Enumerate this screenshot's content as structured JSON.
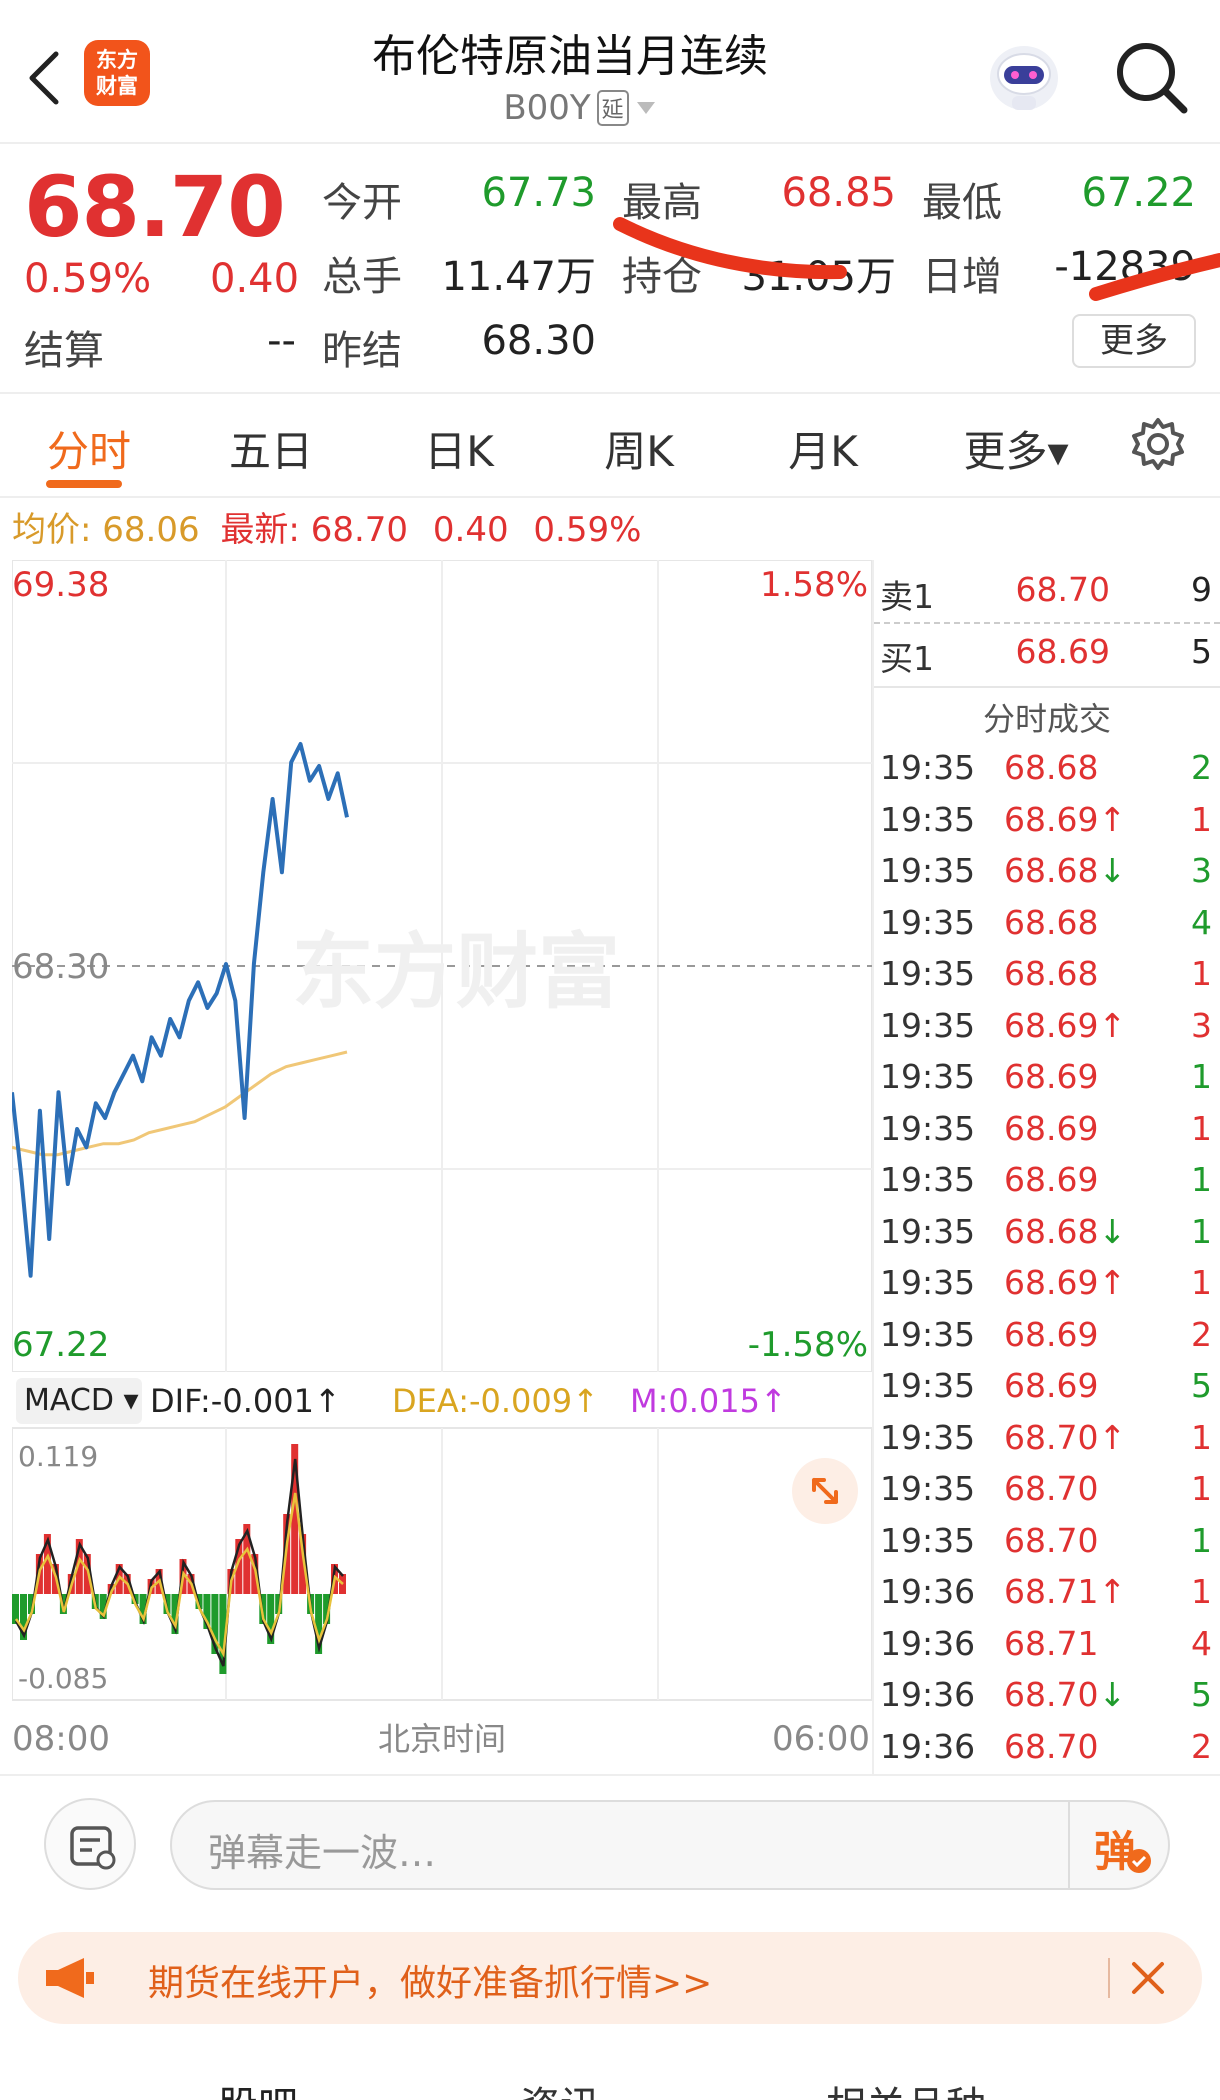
{
  "header": {
    "logo_text_line1": "东方",
    "logo_text_line2": "财富",
    "title": "布伦特原油当月连续",
    "code": "B00Y",
    "code_badge": "延"
  },
  "quote": {
    "price": "68.70",
    "change_pct": "0.59%",
    "change": "0.40",
    "items": {
      "open_label": "今开",
      "open": "67.73",
      "high_label": "最高",
      "high": "68.85",
      "low_label": "最低",
      "low": "67.22",
      "volume_label": "总手",
      "volume": "11.47万",
      "oi_label": "持仓",
      "oi": "31.05万",
      "daily_inc_label": "日增",
      "daily_inc": "-12839",
      "settle_label": "结算",
      "settle": "--",
      "prev_settle_label": "昨结",
      "prev_settle": "68.30"
    },
    "more_label": "更多"
  },
  "tabs": [
    {
      "label": "分时",
      "active": true
    },
    {
      "label": "五日"
    },
    {
      "label": "日K"
    },
    {
      "label": "周K"
    },
    {
      "label": "月K"
    },
    {
      "label": "更多▾"
    }
  ],
  "info_line": {
    "avg_label": "均价:",
    "avg": "68.06",
    "latest_label": "最新:",
    "latest": "68.70",
    "change": "0.40",
    "change_pct": "0.59%"
  },
  "chart": {
    "top_price": "69.38",
    "mid_price": "68.30",
    "bottom_price": "67.22",
    "top_pct": "1.58%",
    "bottom_pct": "-1.58%",
    "watermark": "东方财富",
    "macd_selector": "MACD ▾",
    "dif": "DIF:-0.001↑",
    "dea": "DEA:-0.009↑",
    "m": "M:0.015↑",
    "macd_top": "0.119",
    "macd_bottom": "-0.085",
    "x_start": "08:00",
    "x_mid": "北京时间",
    "x_end": "06:00",
    "colors": {
      "price_line": "#2c6fb7",
      "avg_line": "#f0c777",
      "up": "#e03131",
      "down": "#1f9b2c"
    }
  },
  "chart_data": {
    "type": "line",
    "title": "",
    "xlabel": "北京时间",
    "ylabel": "",
    "x_range": [
      "08:00",
      "06:00"
    ],
    "ylim": [
      67.22,
      69.38
    ],
    "series": [
      {
        "values": [
          67.95,
          67.72,
          67.45,
          67.9,
          67.55,
          67.95,
          67.7,
          67.85,
          67.8,
          67.92,
          67.88,
          67.95,
          68.0,
          68.05,
          67.98,
          68.1,
          68.05,
          68.15,
          68.1,
          68.2,
          68.25,
          68.18,
          68.22,
          68.3,
          68.2,
          67.88,
          68.3,
          68.55,
          68.75,
          68.55,
          68.85,
          68.9,
          68.8,
          68.84,
          68.75,
          68.82,
          68.7
        ]
      },
      {
        "values": [
          67.8,
          67.79,
          67.78,
          67.78,
          67.79,
          67.8,
          67.81,
          67.81,
          67.82,
          67.84,
          67.85,
          67.86,
          67.87,
          67.89,
          67.91,
          67.94,
          67.97,
          68.0,
          68.02,
          68.03,
          68.04,
          68.05,
          68.06
        ]
      }
    ],
    "labels": [
      "69.38",
      "68.30",
      "67.22",
      "1.58%",
      "-1.58%"
    ]
  },
  "orderbook": {
    "sell": {
      "label": "卖1",
      "price": "68.70",
      "vol": "9"
    },
    "buy": {
      "label": "买1",
      "price": "68.69",
      "vol": "5"
    },
    "trades_title": "分时成交",
    "trades": [
      {
        "time": "19:35",
        "price": "68.68",
        "vol": "2",
        "dir": ""
      },
      {
        "time": "19:35",
        "price": "68.69↑",
        "vol": "1",
        "dir": "up"
      },
      {
        "time": "19:35",
        "price": "68.68↓",
        "vol": "3",
        "dir": "down"
      },
      {
        "time": "19:35",
        "price": "68.68",
        "vol": "4",
        "dir": ""
      },
      {
        "time": "19:35",
        "price": "68.68",
        "vol": "1",
        "dir": ""
      },
      {
        "time": "19:35",
        "price": "68.69↑",
        "vol": "3",
        "dir": "up"
      },
      {
        "time": "19:35",
        "price": "68.69",
        "vol": "1",
        "dir": ""
      },
      {
        "time": "19:35",
        "price": "68.69",
        "vol": "1",
        "dir": ""
      },
      {
        "time": "19:35",
        "price": "68.69",
        "vol": "1",
        "dir": ""
      },
      {
        "time": "19:35",
        "price": "68.68↓",
        "vol": "1",
        "dir": "down"
      },
      {
        "time": "19:35",
        "price": "68.69↑",
        "vol": "1",
        "dir": "up"
      },
      {
        "time": "19:35",
        "price": "68.69",
        "vol": "2",
        "dir": ""
      },
      {
        "time": "19:35",
        "price": "68.69",
        "vol": "5",
        "dir": ""
      },
      {
        "time": "19:35",
        "price": "68.70↑",
        "vol": "1",
        "dir": "up"
      },
      {
        "time": "19:35",
        "price": "68.70",
        "vol": "1",
        "dir": ""
      },
      {
        "time": "19:35",
        "price": "68.70",
        "vol": "1",
        "dir": ""
      },
      {
        "time": "19:36",
        "price": "68.71↑",
        "vol": "1",
        "dir": "up"
      },
      {
        "time": "19:36",
        "price": "68.71",
        "vol": "4",
        "dir": ""
      },
      {
        "time": "19:36",
        "price": "68.70↓",
        "vol": "5",
        "dir": "down"
      },
      {
        "time": "19:36",
        "price": "68.70",
        "vol": "2",
        "dir": ""
      }
    ],
    "vol_colors": [
      "green",
      "red",
      "green",
      "green",
      "red",
      "red",
      "green",
      "red",
      "green",
      "green",
      "red",
      "red",
      "green",
      "red",
      "red",
      "green",
      "red",
      "red",
      "green",
      "red"
    ]
  },
  "input": {
    "placeholder": "弹幕走一波…",
    "send_label": "弹"
  },
  "banner": {
    "text": "期货在线开户，做好准备抓行情>>"
  },
  "bottom_tabs": [
    "股吧",
    "资讯",
    "相关品种"
  ]
}
